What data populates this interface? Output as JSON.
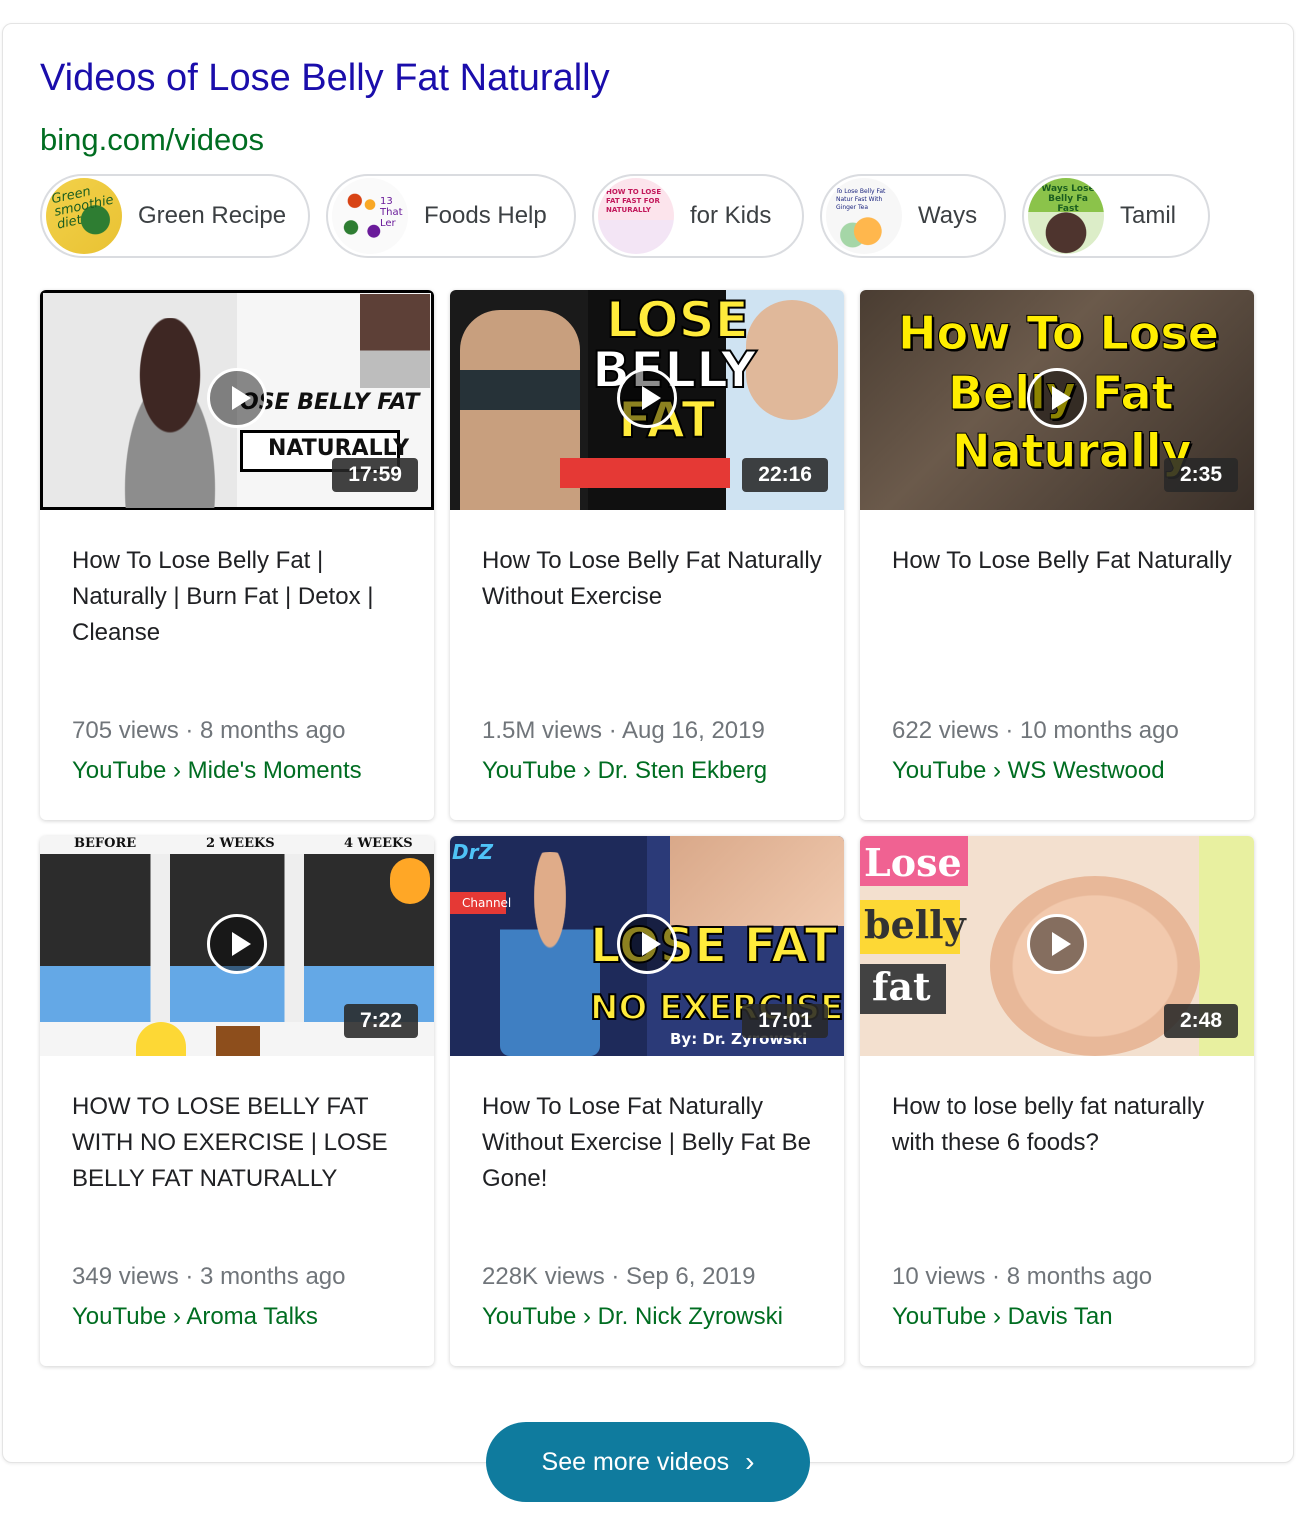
{
  "header": {
    "title": "Videos of Lose Belly Fat Naturally",
    "source": "bing.com/videos"
  },
  "pills": [
    {
      "label": "Green Recipe",
      "thumb_text": "Green smoothie diet"
    },
    {
      "label": "Foods Help",
      "thumb_text": "13 That Ler"
    },
    {
      "label": "for Kids",
      "thumb_text": "HOW TO LOSE FAT FAST FOR NATURALLY"
    },
    {
      "label": "Ways",
      "thumb_text": "To Lose Belly Fat Natur Fast With Ginger Tea"
    },
    {
      "label": "Tamil",
      "thumb_text": "Ways Lose Belly Fa Fast"
    }
  ],
  "videos": [
    {
      "title": "How To Lose Belly Fat | Naturally | Burn Fat | Detox | Cleanse",
      "duration": "17:59",
      "meta": "705 views · 8 months ago",
      "channel": "YouTube › Mide's Moments",
      "overlay": [
        "OSE BELLY FAT",
        "NATURALLY"
      ]
    },
    {
      "title": "How To Lose Belly Fat Naturally Without Exercise",
      "duration": "22:16",
      "meta": "1.5M views · Aug 16, 2019",
      "channel": "YouTube › Dr. Sten Ekberg",
      "overlay": [
        "LOSE",
        "BELLY",
        "FAT"
      ]
    },
    {
      "title": "How To Lose Belly Fat Naturally",
      "duration": "2:35",
      "meta": "622 views · 10 months ago",
      "channel": "YouTube › WS Westwood",
      "overlay": [
        "How To Lose",
        "Belly Fat",
        "Naturally"
      ]
    },
    {
      "title": "HOW TO LOSE BELLY FAT WITH NO EXERCISE | LOSE BELLY FAT NATURALLY",
      "duration": "7:22",
      "meta": "349 views · 3 months ago",
      "channel": "YouTube › Aroma Talks",
      "overlay": [
        "BEFORE",
        "2 WEEKS",
        "4 WEEKS"
      ]
    },
    {
      "title": "How To Lose Fat Naturally Without Exercise | Belly Fat Be Gone!",
      "duration": "17:01",
      "meta": "228K views · Sep 6, 2019",
      "channel": "YouTube › Dr. Nick Zyrowski",
      "overlay": [
        "LOSE FAT",
        "NO EXERCISE",
        "By: Dr. Zyrowski",
        "Channel",
        "DrZ"
      ]
    },
    {
      "title": "How to lose belly fat naturally with these 6 foods?",
      "duration": "2:48",
      "meta": "10 views · 8 months ago",
      "channel": "YouTube › Davis Tan",
      "overlay": [
        "Lose",
        "belly",
        "fat"
      ]
    }
  ],
  "see_more": {
    "label": "See more videos",
    "icon": "chevron-right-icon"
  },
  "colors": {
    "title_link": "#1a0dab",
    "source_green": "#006d21",
    "button_teal": "#0f7b9e"
  }
}
